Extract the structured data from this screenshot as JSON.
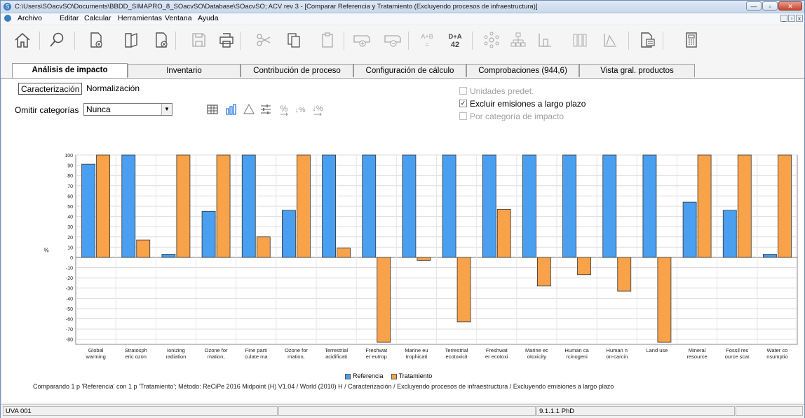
{
  "window": {
    "title": "C:\\Users\\SOacvSO\\Documents\\BBDD_SIMAPRO_8_SOacvSO\\Database\\SOacvSO; ACV rev 3 - [Comparar Referencia y Tratamiento (Excluyendo procesos de infraestructura)]",
    "minimize": "—",
    "maximize": "▫",
    "close": "✕"
  },
  "menu": {
    "items": [
      "Archivo",
      "Editar",
      "Calcular",
      "Herramientas",
      "Ventana",
      "Ayuda"
    ],
    "mdi_minimize": "_",
    "mdi_restore": "▫",
    "mdi_close": "x"
  },
  "toolbar": {
    "icons": [
      "home-icon",
      "search-icon",
      "new-document-icon",
      "open-document-icon",
      "delete-document-icon",
      "save-icon",
      "print-icon",
      "cut-icon",
      "copy-icon",
      "paste-icon",
      "add-process-icon",
      "remove-process-icon",
      "a-plus-b-icon",
      "d-plus-a-icon",
      "network-icon",
      "tree-icon",
      "single-bar-icon",
      "bars-icon",
      "line-chart-icon",
      "report-icon",
      "calculator-icon"
    ],
    "ab_label": "A+B",
    "da_label": "D+A",
    "da_number": "42"
  },
  "tabs": [
    {
      "label": "Análisis de impacto",
      "active": true
    },
    {
      "label": "Inventario",
      "active": false
    },
    {
      "label": "Contribución de proceso",
      "active": false
    },
    {
      "label": "Configuración de cálculo",
      "active": false
    },
    {
      "label": "Comprobaciones (944,6)",
      "active": false
    },
    {
      "label": "Vista gral. productos",
      "active": false
    }
  ],
  "subtabs": {
    "characterization": "Caracterización",
    "normalization": "Normalización"
  },
  "omit": {
    "label": "Omitir categorías",
    "value": "Nunca"
  },
  "small_tools": {
    "percent_label": "%",
    "percent_down": "↓%",
    "percent_down2": "↓%"
  },
  "options": {
    "default_units": {
      "label": "Unidades predet.",
      "checked": false,
      "enabled": false
    },
    "exclude_long_term": {
      "label": "Excluir emisiones a largo plazo",
      "checked": true,
      "enabled": true
    },
    "per_impact_category": {
      "label": "Por categoría de impacto",
      "checked": false,
      "enabled": false
    }
  },
  "chart_data": {
    "type": "bar",
    "ylabel": "%",
    "ylim": [
      -85,
      100
    ],
    "yticks": [
      100,
      90,
      80,
      70,
      60,
      50,
      40,
      30,
      20,
      10,
      0,
      -10,
      -20,
      -30,
      -40,
      -50,
      -60,
      -70,
      -80
    ],
    "grid": true,
    "legend_position": "bottom",
    "categories": [
      [
        "Global",
        "warming"
      ],
      [
        "Stratosph",
        "eric ozon"
      ],
      [
        "Ionizing",
        "radiation"
      ],
      [
        "Ozone for",
        "mation,"
      ],
      [
        "Fine parti",
        "culate ma"
      ],
      [
        "Ozone for",
        "mation,"
      ],
      [
        "Terrestrial",
        "acidificati"
      ],
      [
        "Freshwat",
        "er eutrop"
      ],
      [
        "Marine eu",
        "trophicati"
      ],
      [
        "Terrestrial",
        "ecotoxicit"
      ],
      [
        "Freshwat",
        "er ecotoxi"
      ],
      [
        "Marine ec",
        "otoxicity"
      ],
      [
        "Human ca",
        "rcinogeni"
      ],
      [
        "Human n",
        "on-carcin"
      ],
      [
        "Land use",
        ""
      ],
      [
        "Mineral",
        "resource"
      ],
      [
        "Fossil res",
        "ource scar"
      ],
      [
        "Water co",
        "nsumptio"
      ]
    ],
    "series": [
      {
        "name": "Referencia",
        "color": "#4a9ff0",
        "values": [
          91,
          100,
          3,
          45,
          100,
          46,
          100,
          100,
          100,
          100,
          100,
          100,
          100,
          100,
          100,
          54,
          46,
          3
        ]
      },
      {
        "name": "Tratamiento",
        "color": "#f8a24a",
        "values": [
          100,
          17,
          100,
          100,
          20,
          100,
          9,
          -83,
          -3,
          -63,
          47,
          -28,
          -17,
          -33,
          -83,
          100,
          100,
          100
        ]
      }
    ]
  },
  "caption": "Comparando 1 p 'Referencia' con 1 p 'Tratamiento'; Método: ReCiPe 2016 Midpoint (H) V1.04 / World (2010) H / Caracterización / Excluyendo procesos de infraestructura / Excluyendo emisiones a largo plazo",
  "status": {
    "left": "UVA 001",
    "middle": "",
    "right": "9.1.1.1 PhD",
    "far_right": ""
  }
}
